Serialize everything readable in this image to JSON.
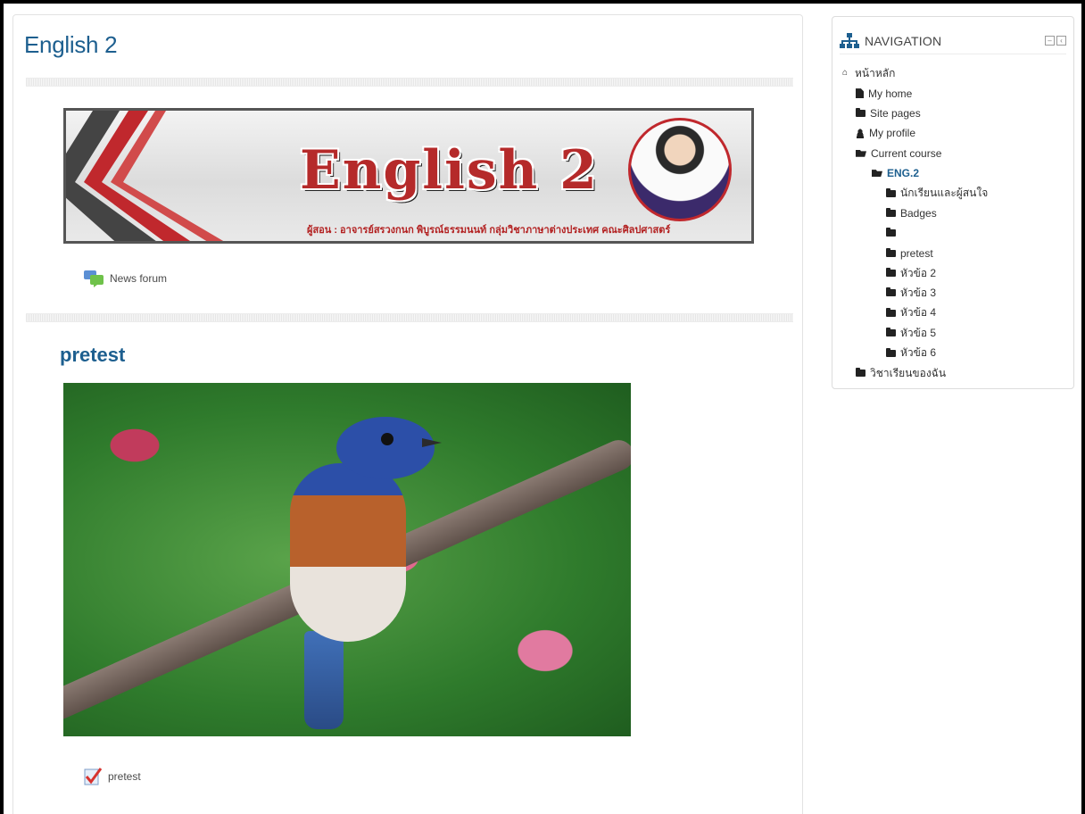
{
  "course": {
    "title": "English 2",
    "banner_title": "English 2",
    "banner_caption": "ผู้สอน : อาจารย์สรวงกนก พิบูรณ์ธรรมนนท์ กลุ่มวิชาภาษาต่างประเทศ คณะศิลปศาสตร์",
    "news_forum_label": "News forum",
    "section1": {
      "title": "pretest",
      "activity_label": "pretest"
    }
  },
  "navigation": {
    "title": "NAVIGATION",
    "items": [
      {
        "label": "หน้าหลัก",
        "icon": "home-icon",
        "indent": 0
      },
      {
        "label": "My home",
        "icon": "document-icon",
        "indent": 1
      },
      {
        "label": "Site pages",
        "icon": "folder-icon",
        "indent": 1
      },
      {
        "label": "My profile",
        "icon": "user-icon",
        "indent": 1
      },
      {
        "label": "Current course",
        "icon": "folder-open-icon",
        "indent": 1
      },
      {
        "label": "ENG.2",
        "icon": "folder-open-icon",
        "indent": 2,
        "strong": true
      },
      {
        "label": "นักเรียนและผู้สนใจ",
        "icon": "folder-icon",
        "indent": 3
      },
      {
        "label": "Badges",
        "icon": "folder-icon",
        "indent": 3
      },
      {
        "label": "",
        "icon": "folder-icon",
        "indent": 3
      },
      {
        "label": "pretest",
        "icon": "folder-icon",
        "indent": 3
      },
      {
        "label": "หัวข้อ 2",
        "icon": "folder-icon",
        "indent": 3
      },
      {
        "label": "หัวข้อ 3",
        "icon": "folder-icon",
        "indent": 3
      },
      {
        "label": "หัวข้อ 4",
        "icon": "folder-icon",
        "indent": 3
      },
      {
        "label": "หัวข้อ 5",
        "icon": "folder-icon",
        "indent": 3
      },
      {
        "label": "หัวข้อ 6",
        "icon": "folder-icon",
        "indent": 3
      },
      {
        "label": "วิชาเรียนของฉัน",
        "icon": "folder-icon",
        "indent": 1
      }
    ]
  },
  "colors": {
    "title_blue": "#1d5f8f",
    "banner_red": "#b52a2a"
  }
}
